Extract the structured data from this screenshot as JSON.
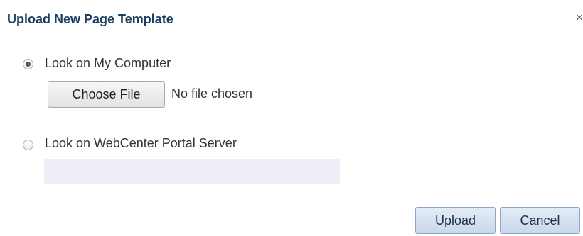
{
  "dialog": {
    "title": "Upload New Page Template",
    "close_label": "×"
  },
  "options": {
    "computer": {
      "label": "Look on My Computer",
      "selected": true,
      "file_button_label": "Choose File",
      "file_status": "No file chosen"
    },
    "server": {
      "label": "Look on WebCenter Portal Server",
      "selected": false,
      "field_value": ""
    }
  },
  "actions": {
    "upload_label": "Upload",
    "cancel_label": "Cancel"
  },
  "colors": {
    "title": "#1b3f63",
    "button_fill": "#c9d8ec",
    "field_fill": "#eeeff6"
  },
  "icons": {
    "close": "close-icon"
  }
}
